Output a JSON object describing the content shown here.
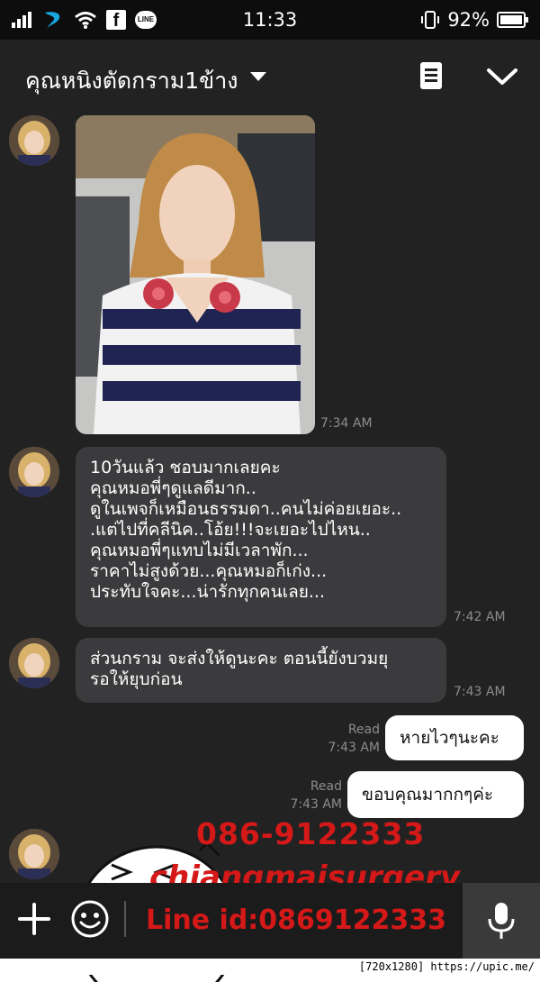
{
  "status_bar": {
    "time": "11:33",
    "battery": "92%",
    "line_icon_text": "LINE",
    "facebook_icon_text": "f",
    "icons": [
      "signal-icon",
      "dtac-icon",
      "wifi-icon",
      "facebook-icon",
      "line-icon",
      "vibrate-icon",
      "battery-icon"
    ]
  },
  "header": {
    "title": "คุณหนิงตัดกราม1ข้าง",
    "icons": [
      "dropdown-caret-icon",
      "notes-icon",
      "chevron-down-icon"
    ]
  },
  "messages": [
    {
      "type": "image",
      "time": "7:34 AM"
    },
    {
      "type": "text",
      "lines": [
        "10วันแล้ว  ชอบมากเลยคะ",
        "คุณหมอพี่ๆดูแลดีมาก..",
        "ดูในเพจก็เหมือนธรรมดา..คนไม่ค่อยเยอะ..",
        ".แต่ไปที่คลีนิค..โอ้ย!!!จะเยอะไปไหน..",
        "คุณหมอพี่ๆแทบไม่มีเวลาพัก...",
        "ราคาไม่สูงด้วย...คุณหมอก็เก่ง...",
        "ประทับใจคะ...น่ารักทุกคนเลย..."
      ],
      "time": "7:42 AM"
    },
    {
      "type": "text",
      "lines": [
        "ส่วนกราม จะส่งให้ดูนะคะ ตอนนี้ยังบวมยุ",
        "รอให้ยุบก่อน"
      ],
      "time": "7:43 AM"
    },
    {
      "type": "outgoing",
      "text": "หายไวๆนะคะ",
      "read": "Read",
      "time": "7:43 AM"
    },
    {
      "type": "outgoing",
      "text": "ขอบคุณมากกๆค่ะ",
      "read": "Read",
      "time": "7:43 AM"
    }
  ],
  "watermark": {
    "phone": "086-9122333",
    "brand": "chiangmaisurgery",
    "line_id": "Line id:0869122333"
  },
  "input_bar": {
    "icons": [
      "plus-icon",
      "emoji-icon",
      "mic-icon"
    ]
  },
  "footer_tag": "[720x1280] https://upic.me/",
  "colors": {
    "background": "#222222",
    "incoming_bubble": "#3b3b3d",
    "outgoing_bubble": "#ffffff",
    "watermark": "#d51818"
  }
}
